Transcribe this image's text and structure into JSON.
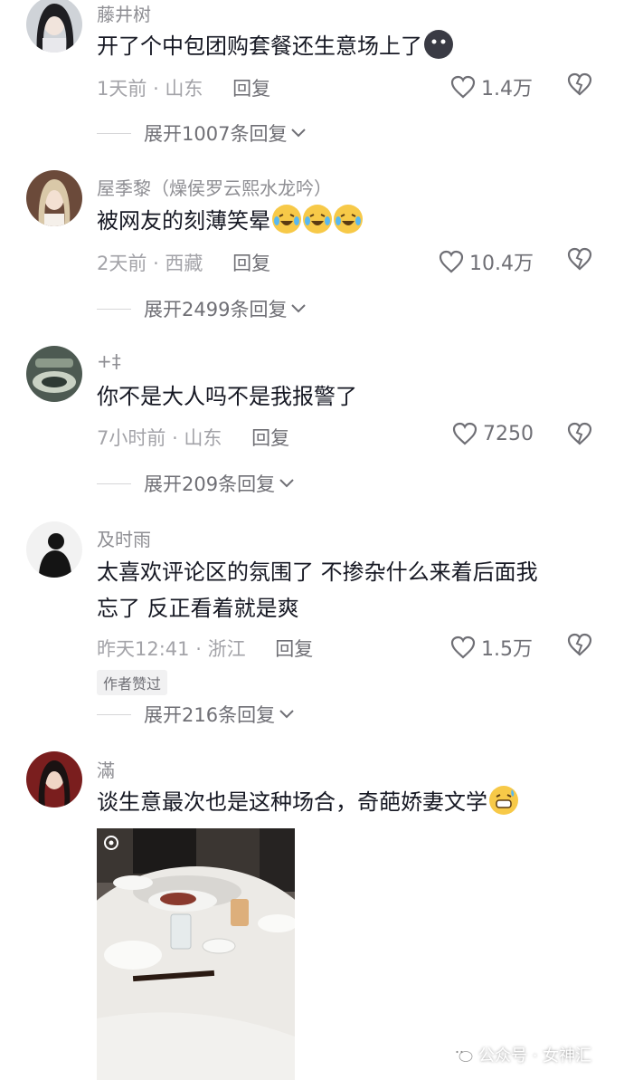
{
  "comments": [
    {
      "username": "藤井树",
      "text": "开了个中包团购套餐还生意场上了",
      "time": "1天前",
      "location": "山东",
      "reply_label": "回复",
      "likes": "1.4万",
      "expand_label": "展开1007条回复",
      "emoji": [
        "dark-face-emoji"
      ]
    },
    {
      "username": "屋季黎（燥侯罗云熙水龙吟）",
      "text": "被网友的刻薄笑晕",
      "time": "2天前",
      "location": "西藏",
      "reply_label": "回复",
      "likes": "10.4万",
      "expand_label": "展开2499条回复",
      "emoji": [
        "laugh-cry-emoji",
        "laugh-cry-emoji",
        "laugh-cry-emoji"
      ]
    },
    {
      "username": "+‡",
      "text": "你不是大人吗不是我报警了",
      "time": "7小时前",
      "location": "山东",
      "reply_label": "回复",
      "likes": "7250",
      "expand_label": "展开209条回复"
    },
    {
      "username": "及时雨",
      "text_line1": "太喜欢评论区的氛围了 不掺杂什么来着后面我",
      "text_line2": "忘了 反正看着就是爽",
      "time": "昨天12:41",
      "location": "浙江",
      "reply_label": "回复",
      "likes": "1.5万",
      "badge": "作者赞过",
      "expand_label": "展开216条回复"
    },
    {
      "username": "滿",
      "text": "谈生意最次也是这种场合，奇葩娇妻文学",
      "emoji": [
        "grin-sweat-emoji"
      ]
    }
  ],
  "watermark": {
    "text": "公众号 · 女神汇",
    "icon": "wechat-icon"
  },
  "colors": {
    "primary_text": "#161823",
    "secondary_text": "#8e8e93",
    "meta_text": "#a3a3a8",
    "divider": "#d6d6d8"
  }
}
